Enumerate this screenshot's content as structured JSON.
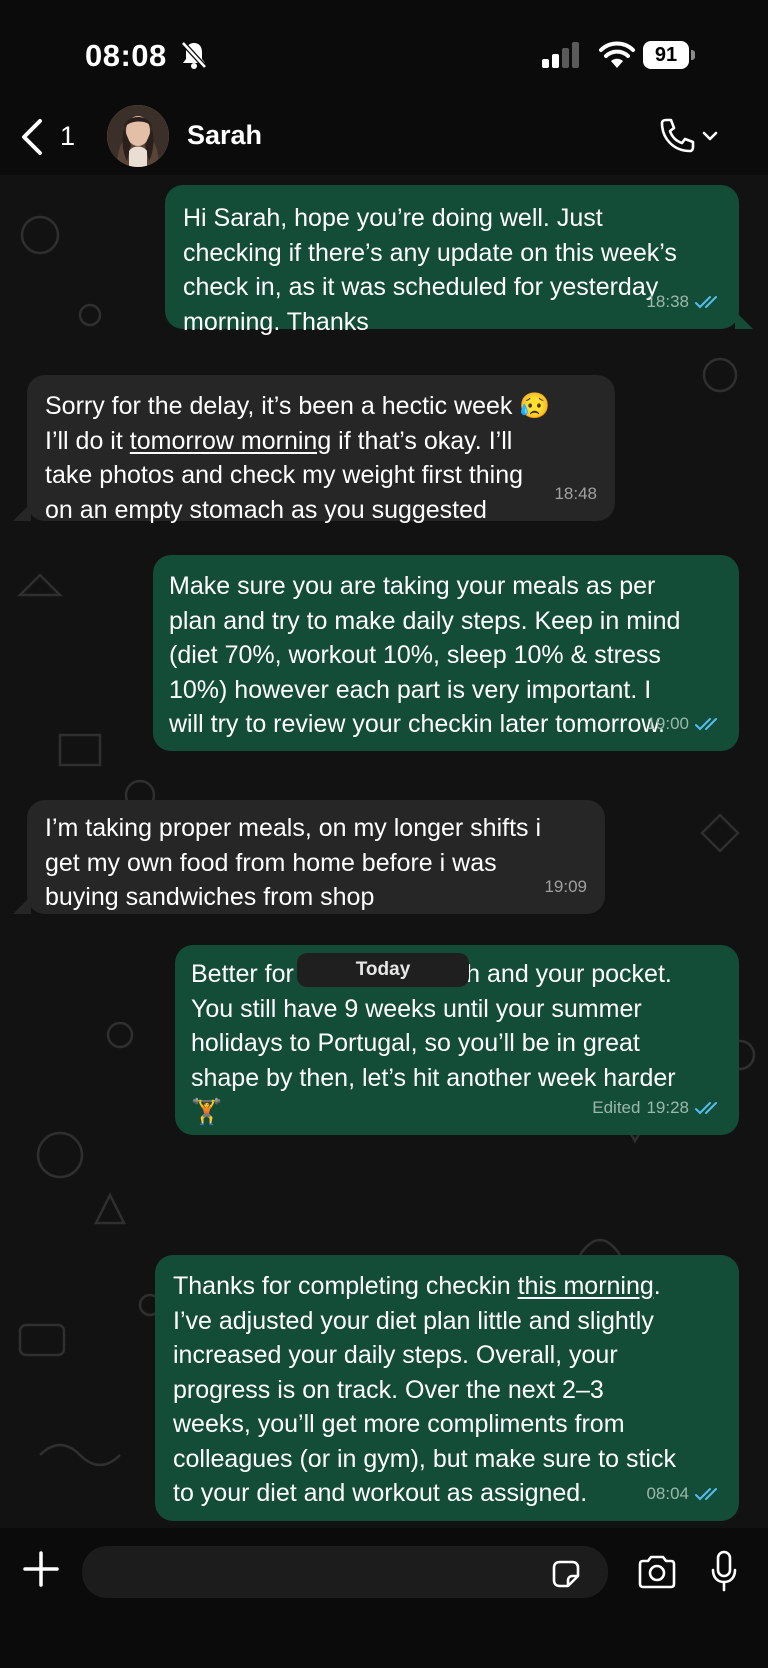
{
  "status_bar": {
    "time": "08:08",
    "battery": "91"
  },
  "header": {
    "back_count": "1",
    "contact_name": "Sarah"
  },
  "messages": [
    {
      "text": "Hi Sarah, hope you’re doing well. Just\nchecking if there’s any update on this week’s\ncheck in, as it was scheduled for yesterday\nmorning. Thanks",
      "time": "18:38"
    },
    {
      "text_a": "Sorry for the delay, it’s been a hectic week 😥\nI’ll do it ",
      "link": "tomorrow morning",
      "text_b": " if that’s okay. I’ll\ntake photos and check my weight first thing\non an empty stomach as you suggested",
      "time": "18:48"
    },
    {
      "text": "Make sure you are taking your meals as per\nplan and try to make daily steps. Keep in mind\n(diet 70%, workout 10%, sleep 10% & stress\n10%) however each part is very important. I\nwill try to review your checkin later tomorrow.",
      "time": "19:00"
    },
    {
      "text": "I’m taking proper meals, on my longer shifts i\nget my own food from home before i was\nbuying sandwiches from shop",
      "time": "19:09"
    },
    {
      "text": "Better for both your health and your pocket.\nYou still have 9 weeks until your summer\nholidays to Portugal, so you’ll be in great\nshape by then, let’s hit another week harder\n🏋️",
      "edited": "Edited",
      "time": "19:28"
    },
    {
      "text_a": "Thanks for completing checkin ",
      "link": "this morning",
      "text_b": ".\nI’ve adjusted your diet plan little and slightly\nincreased your daily steps. Overall, your\nprogress is on track. Over the next 2–3\nweeks, you’ll get more compliments from\ncolleagues (or in gym), but make sure to stick\nto your diet and workout as assigned.",
      "time": "08:04"
    }
  ],
  "date_divider": "Today",
  "composer": {
    "placeholder": ""
  },
  "icons": {
    "status": [
      "bell-slash-icon",
      "signal-icon",
      "wifi-icon",
      "battery-icon"
    ],
    "header": [
      "chevron-left-icon",
      "avatar",
      "phone-icon",
      "chevron-down-icon"
    ],
    "composer": [
      "plus-icon",
      "sticker-icon",
      "camera-icon",
      "microphone-icon"
    ]
  },
  "colors": {
    "outgoing_bubble": "#144d37",
    "incoming_bubble": "#262626",
    "read_ticks": "#53bdeb",
    "background": "#0b0b0b"
  }
}
